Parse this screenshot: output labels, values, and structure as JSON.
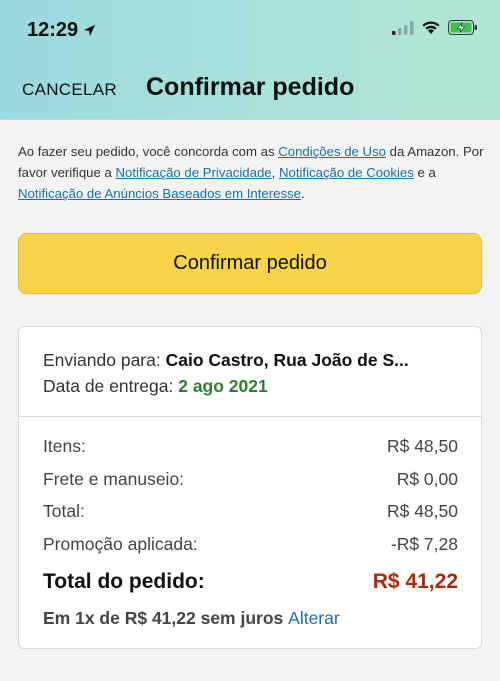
{
  "status_bar": {
    "time": "12:29"
  },
  "header": {
    "cancel_label": "CANCELAR",
    "title": "Confirmar pedido"
  },
  "notice": {
    "text1": "Ao fazer seu pedido, você concorda com as ",
    "link_terms": "Condições de Uso",
    "text2": " da Amazon. Por favor verifique a ",
    "link_privacy": "Notificação de Privacidade",
    "text3": ", ",
    "link_cookies": "Notificação de Cookies",
    "text4": " e a ",
    "link_ads": "Notificação de Anúncios Baseados em Interesse",
    "text5": "."
  },
  "confirm_button": "Confirmar pedido",
  "shipping": {
    "to_label": "Enviando para: ",
    "to_value": "Caio Castro, Rua João de S...",
    "date_label": "Data de entrega: ",
    "date_value": "2 ago 2021"
  },
  "summary": {
    "rows": [
      {
        "label": "Itens:",
        "value": "R$ 48,50"
      },
      {
        "label": "Frete e manuseio:",
        "value": "R$ 0,00"
      },
      {
        "label": "Total:",
        "value": "R$ 48,50"
      },
      {
        "label": "Promoção aplicada:",
        "value": "-R$ 7,28"
      }
    ],
    "order_total_label": "Total do pedido:",
    "order_total_value": "R$ 41,22",
    "installment_text": "Em 1x de R$ 41,22 sem juros ",
    "change_link": "Alterar"
  },
  "colors": {
    "accent_button": "#f7d44a",
    "link": "#1a6fa8",
    "price": "#b12704",
    "delivery": "#2e7d32"
  },
  "icons": [
    "location-arrow-icon",
    "cellular-signal-icon",
    "wifi-icon",
    "battery-charging-icon"
  ]
}
